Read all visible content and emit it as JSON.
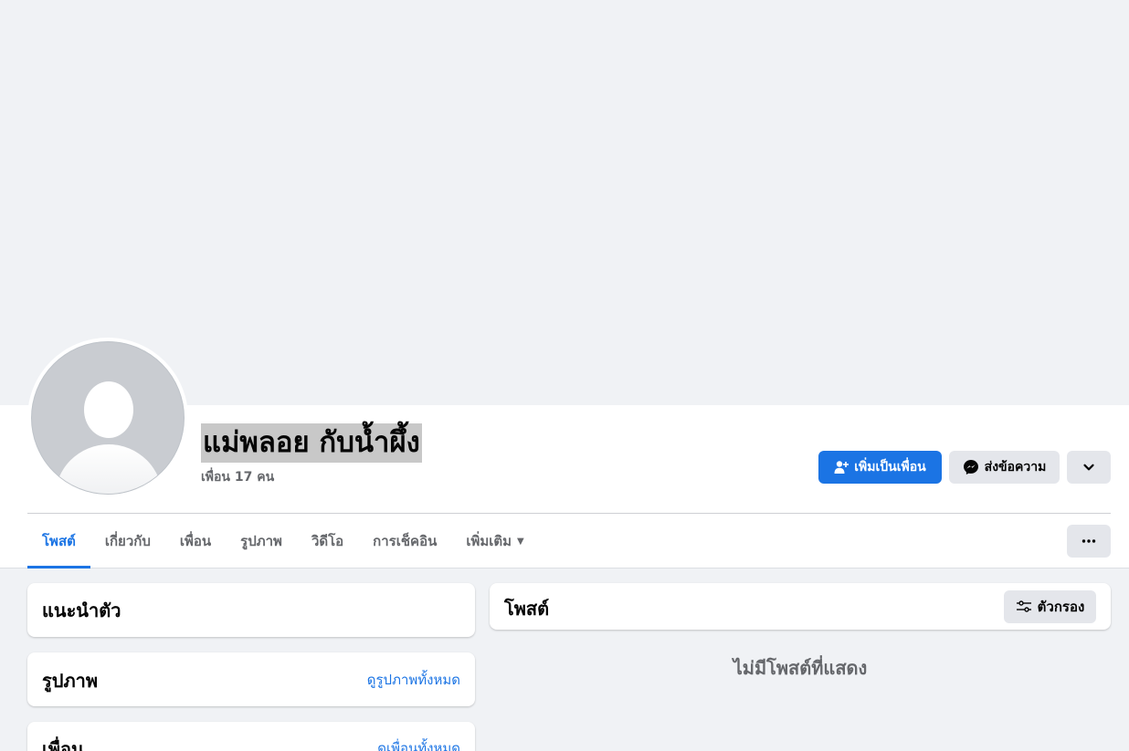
{
  "profile": {
    "name": "แม่พลอย กับน้ำผึ้ง",
    "friend_count_text": "เพื่อน 17 คน"
  },
  "actions": {
    "add_friend_label": "เพิ่มเป็นเพื่อน",
    "message_label": "ส่งข้อความ"
  },
  "tabs": [
    {
      "label": "โพสต์",
      "active": true
    },
    {
      "label": "เกี่ยวกับ"
    },
    {
      "label": "เพื่อน"
    },
    {
      "label": "รูปภาพ"
    },
    {
      "label": "วิดีโอ"
    },
    {
      "label": "การเช็คอิน"
    },
    {
      "label": "เพิ่มเติม"
    }
  ],
  "left_column": {
    "intro_title": "แนะนำตัว",
    "photos_title": "รูปภาพ",
    "photos_link": "ดูรูปภาพทั้งหมด",
    "friends_title": "เพื่อน",
    "friends_link": "ดูเพื่อนทั้งหมด"
  },
  "posts": {
    "title": "โพสต์",
    "filter_label": "ตัวกรอง",
    "empty_text": "ไม่มีโพสต์ที่แสดง"
  },
  "colors": {
    "accent": "#1b74e4",
    "background": "#f0f2f5",
    "secondary_button": "#e4e6eb"
  }
}
